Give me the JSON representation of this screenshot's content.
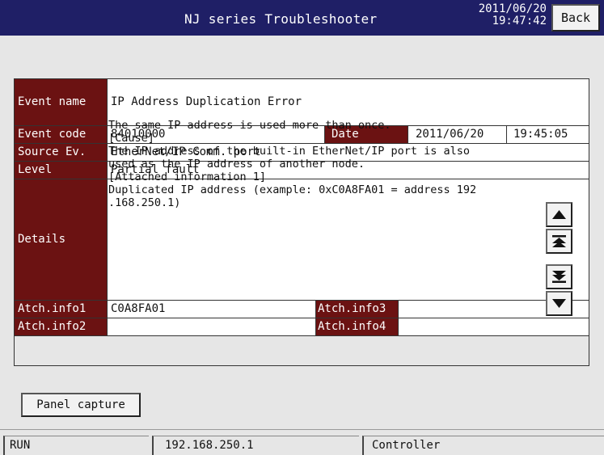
{
  "titlebar": {
    "title": "NJ series Troubleshooter",
    "date": "2011/06/20",
    "time": "19:47:42",
    "back_label": "Back"
  },
  "event": {
    "event_name_label": "Event name",
    "event_name_value": "IP Address Duplication Error",
    "event_code_label": "Event code",
    "event_code_value": "84010000",
    "date_label": "Date",
    "date_value": "2011/06/20",
    "time_value": "19:45:05",
    "source_label": "Source Ev.",
    "source_value": "EtherNet/IP Comm. port",
    "level_label": "Level",
    "level_value": "Partial fault",
    "details_label": "Details",
    "details_lines": [
      "The same IP address is used more than once.",
      "[Cause]",
      "The IP address of the built-in EtherNet/IP port is also",
      "used as the IP address of another node.",
      "[Attached information 1]",
      "Duplicated IP address (example: 0xC0A8FA01 = address 192",
      ".168.250.1)"
    ],
    "atch1_label": "Atch.info1",
    "atch1_value": "C0A8FA01",
    "atch2_label": "Atch.info2",
    "atch2_value": "",
    "atch3_label": "Atch.info3",
    "atch3_value": "",
    "atch4_label": "Atch.info4",
    "atch4_value": ""
  },
  "panel_capture_label": "Panel capture",
  "statusbar": {
    "mode": "RUN",
    "ip": "192.168.250.1",
    "device": "Controller"
  },
  "colors": {
    "titlebar_bg": "#1f1f66",
    "label_bg": "#6b1212",
    "panel_bg": "#e6e6e6"
  },
  "icons": [
    "up-arrow-icon",
    "page-up-icon",
    "page-down-icon",
    "down-arrow-icon"
  ]
}
